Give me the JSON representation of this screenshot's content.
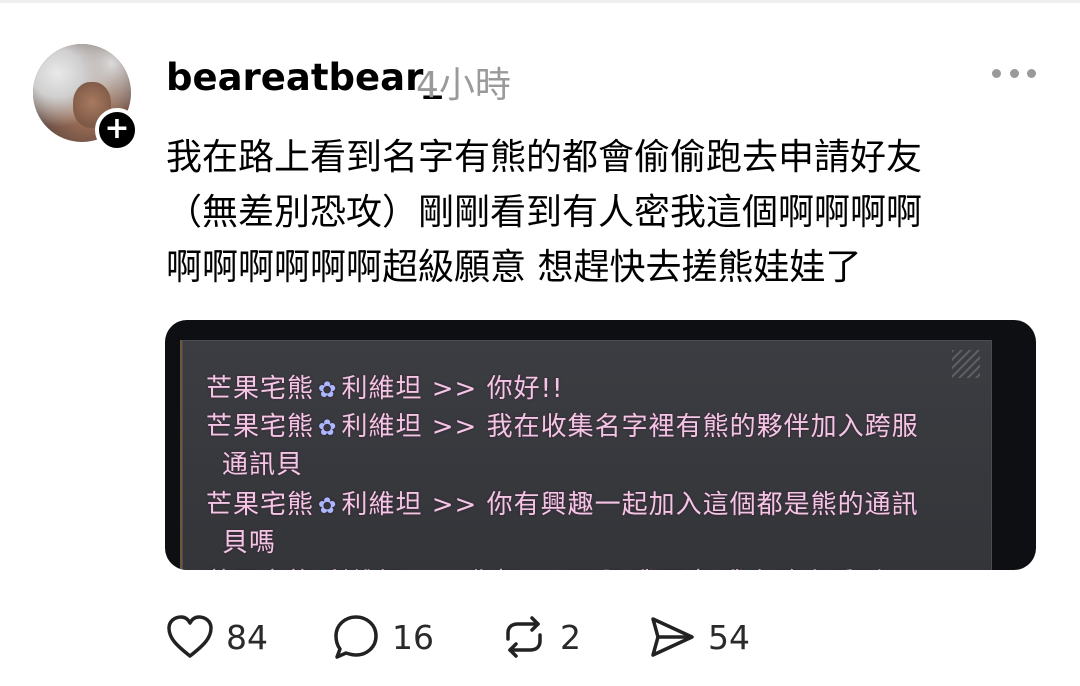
{
  "post": {
    "username": "beareatbear_",
    "timestamp": "4小時",
    "text_lines": [
      "我在路上看到名字有熊的都會偷偷跑去申請好友",
      "（無差別恐攻）剛剛看到有人密我這個啊啊啊啊",
      "啊啊啊啊啊啊超級願意 想趕快去搓熊娃娃了"
    ]
  },
  "image": {
    "chat_lines": [
      {
        "sender": "芒果宅熊",
        "server": "利維坦",
        "message": ">> 你好!!"
      },
      {
        "sender": "芒果宅熊",
        "server": "利維坦",
        "message": ">> 我在收集名字裡有熊的夥伴加入跨服"
      },
      {
        "continuation": "通訊貝"
      },
      {
        "sender": "芒果宅熊",
        "server": "利維坦",
        "message": ">> 你有興趣一起加入這個都是熊的通訊"
      },
      {
        "continuation": "貝嗎"
      },
      {
        "partial": "芒果宅熊 利維坦 >> 你好!!!!不啊 我願意 我在路上看到"
      }
    ]
  },
  "actions": {
    "likes": "84",
    "comments": "16",
    "reposts": "2",
    "shares": "54"
  },
  "icons": {
    "follow": "plus-icon",
    "more": "more-dots-icon",
    "like": "heart-icon",
    "comment": "comment-bubble-icon",
    "repost": "repost-icon",
    "share": "send-icon",
    "server": "flower-icon"
  },
  "colors": {
    "chat_text": "#f2c6e4",
    "timestamp": "#9a9a9a",
    "server_icon": "#a9b8ff"
  }
}
